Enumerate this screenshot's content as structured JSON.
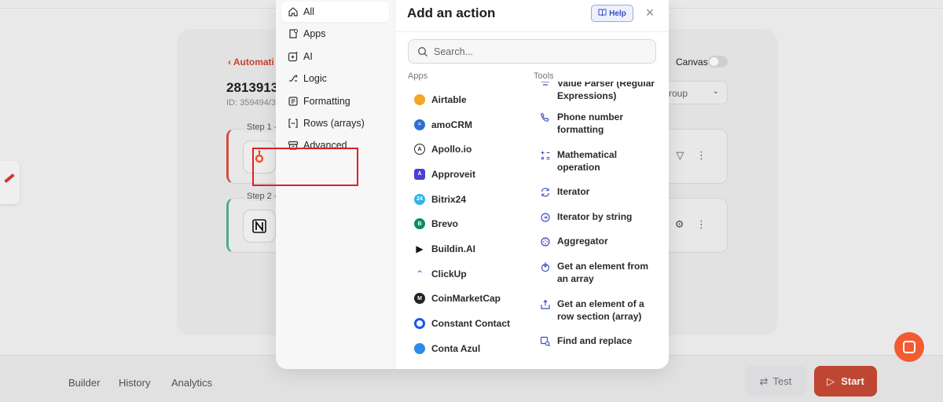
{
  "background": {
    "breadcrumb": "‹  Automati",
    "title": "2813913",
    "id_text": "ID: 359494/3",
    "canvas_label": "Canvas",
    "group_select": "roup",
    "steps": [
      {
        "label": "Step 1 -",
        "icon": "hubspot-icon",
        "accent": "#d9533c"
      },
      {
        "label": "Step 2 -",
        "icon": "notion-icon",
        "accent": "#4fb38a"
      }
    ],
    "bottom_tabs": [
      "Builder",
      "History",
      "Analytics"
    ],
    "test_label": "Test",
    "start_label": "Start"
  },
  "modal": {
    "title": "Add an action",
    "help_label": "Help",
    "search_placeholder": "Search...",
    "nav": [
      {
        "label": "All",
        "icon": "home-icon",
        "active": true
      },
      {
        "label": "Apps",
        "icon": "apps-icon"
      },
      {
        "label": "AI",
        "icon": "ai-sparkle-icon"
      },
      {
        "label": "Logic",
        "icon": "logic-icon"
      },
      {
        "label": "Formatting",
        "icon": "formatting-icon"
      },
      {
        "label": "Rows (arrays)",
        "icon": "array-brackets-icon"
      },
      {
        "label": "Advanced",
        "icon": "advanced-icon"
      }
    ],
    "apps_header": "Apps",
    "tools_header": "Tools",
    "apps": [
      {
        "name": "Airtable",
        "icon": "airtable-icon",
        "color": "#f5a623"
      },
      {
        "name": "amoCRM",
        "icon": "amocrm-icon",
        "color": "#2d6fd6"
      },
      {
        "name": "Apollo.io",
        "icon": "apollo-icon",
        "color": "#222222"
      },
      {
        "name": "Approveit",
        "icon": "approveit-icon",
        "color": "#4b3fd6"
      },
      {
        "name": "Bitrix24",
        "icon": "bitrix24-icon",
        "color": "#2fb6e9"
      },
      {
        "name": "Brevo",
        "icon": "brevo-icon",
        "color": "#0b8f5a"
      },
      {
        "name": "Buildin.AI",
        "icon": "buildin-icon",
        "color": "#111111"
      },
      {
        "name": "ClickUp",
        "icon": "clickup-icon",
        "color": "#7b68ee"
      },
      {
        "name": "CoinMarketCap",
        "icon": "coinmarketcap-icon",
        "color": "#222222"
      },
      {
        "name": "Constant Contact",
        "icon": "constant-contact-icon",
        "color": "#1856ed"
      },
      {
        "name": "Conta Azul",
        "icon": "conta-azul-icon",
        "color": "#2c8be8"
      }
    ],
    "tools": [
      {
        "name": "Value Parser (Regular Expressions)",
        "icon": "regex-parser-icon"
      },
      {
        "name": "Phone number formatting",
        "icon": "phone-icon"
      },
      {
        "name": "Mathematical operation",
        "icon": "math-operation-icon"
      },
      {
        "name": "Iterator",
        "icon": "iterator-icon"
      },
      {
        "name": "Iterator by string",
        "icon": "iterator-string-icon"
      },
      {
        "name": "Aggregator",
        "icon": "aggregator-icon"
      },
      {
        "name": "Get an element from an array",
        "icon": "array-element-icon"
      },
      {
        "name": "Get an element of a row section (array)",
        "icon": "row-section-icon"
      },
      {
        "name": "Find and replace",
        "icon": "find-replace-icon"
      }
    ]
  },
  "colors": {
    "accent_red": "#c84a36",
    "highlight": "#e02020",
    "tool_icon_blue": "#3b4fbf",
    "help_blue": "#3b4fbf"
  }
}
